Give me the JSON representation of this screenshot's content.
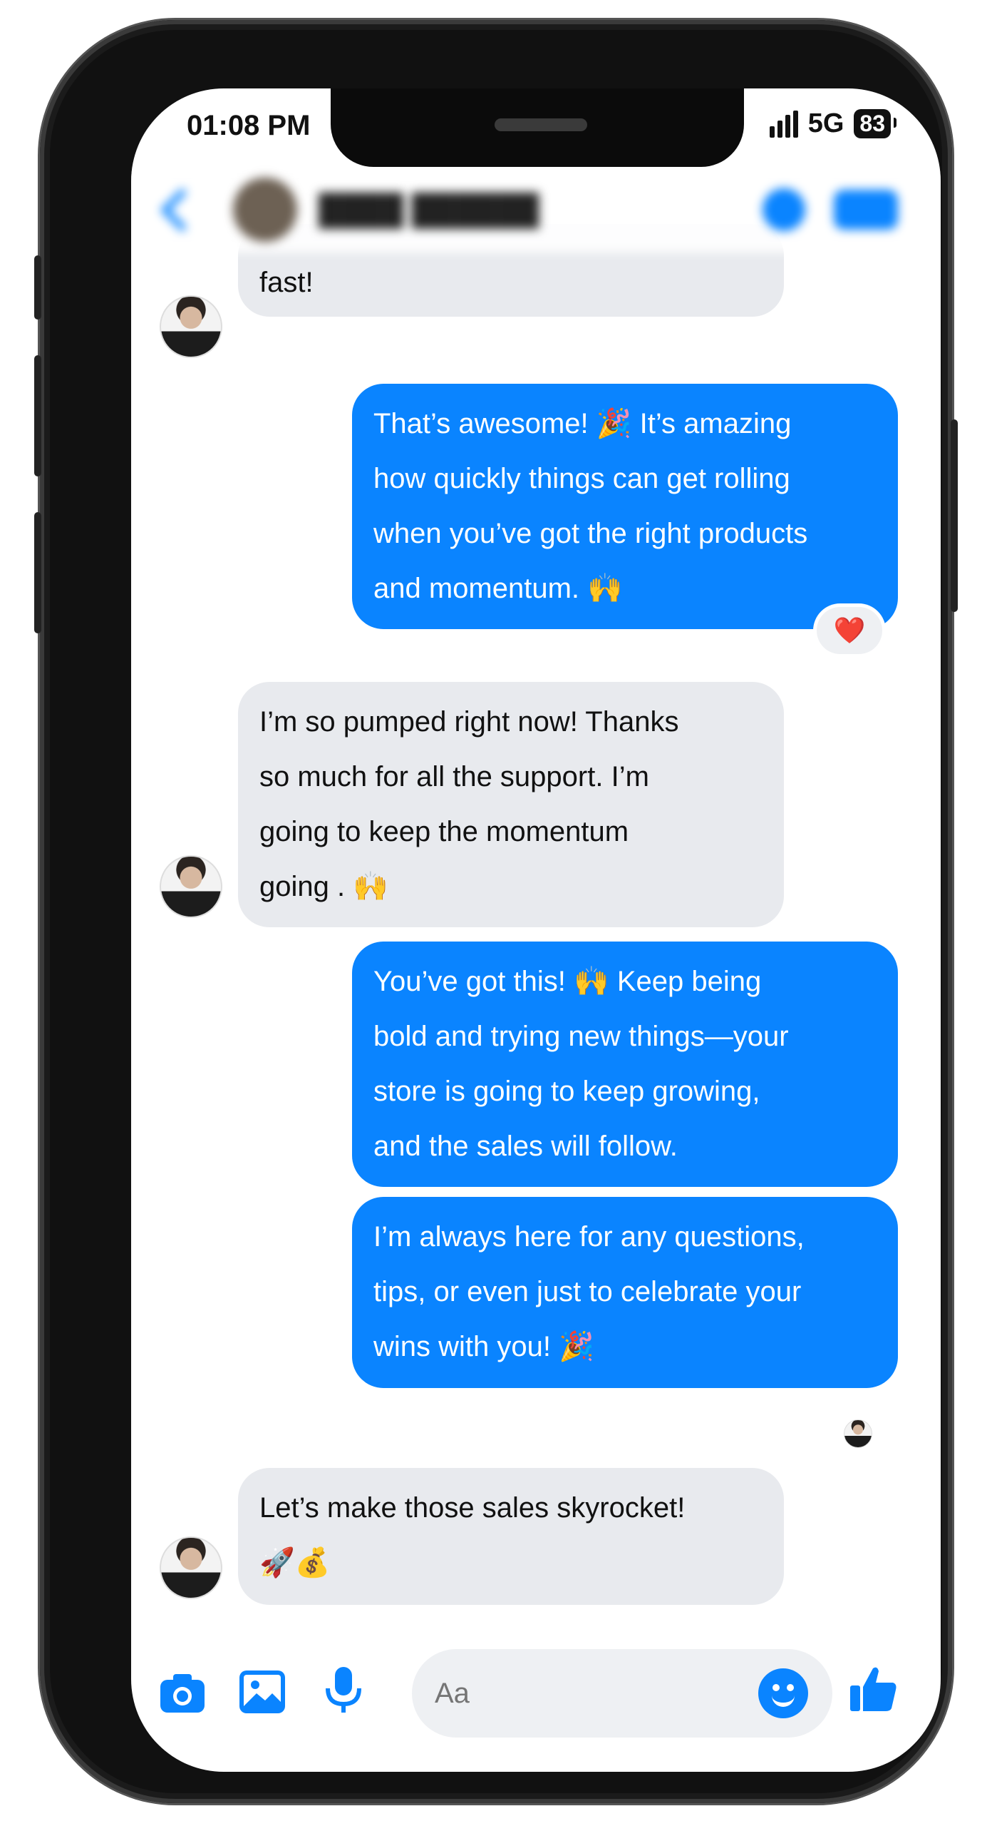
{
  "status_bar": {
    "time": "01:08 PM",
    "network": "5G",
    "battery": "83"
  },
  "composer": {
    "placeholder": "Aa"
  },
  "messages": [
    {
      "lines": [
        "fast!"
      ]
    },
    {
      "lines": [
        "That’s awesome! 🎉 It’s amazing",
        "how quickly things can get rolling",
        "when you’ve got the right products",
        "and momentum. 🙌"
      ],
      "reaction": "❤️"
    },
    {
      "lines": [
        "I’m so pumped right now! Thanks",
        "so much for all the support. I’m",
        "going to keep the momentum",
        "going . 🙌"
      ]
    },
    {
      "lines": [
        "You’ve got this! 🙌 Keep being",
        "bold and trying new things—your",
        "store is going to keep growing,",
        "and the sales will follow."
      ]
    },
    {
      "lines": [
        "I’m always here for any questions,",
        "tips, or even just to celebrate your",
        "wins with you! 🎉"
      ]
    },
    {
      "lines": [
        "Let’s make those sales skyrocket!",
        "🚀💰"
      ]
    }
  ],
  "colors": {
    "accent": "#0a84ff",
    "incoming_bubble": "#e8eaee",
    "outgoing_text": "#ffffff"
  },
  "icons": [
    "camera-icon",
    "image-icon",
    "microphone-icon",
    "emoji-icon",
    "thumbs-up-icon",
    "phone-icon",
    "video-icon",
    "back-icon"
  ]
}
